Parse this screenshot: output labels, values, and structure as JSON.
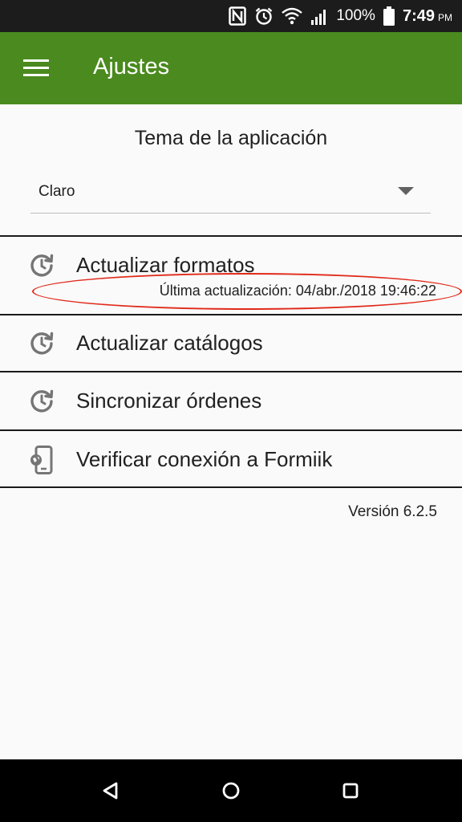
{
  "status_bar": {
    "battery_percent": "100%",
    "time": "7:49",
    "ampm": "PM",
    "icons": [
      "nfc-icon",
      "alarm-icon",
      "wifi-icon",
      "signal-icon",
      "battery-icon"
    ]
  },
  "app_bar": {
    "title": "Ajustes",
    "color": "#4a8a1e",
    "menu_icon": "hamburger-menu-icon"
  },
  "theme": {
    "title": "Tema de la aplicación",
    "selected": "Claro"
  },
  "settings": [
    {
      "label": "Actualizar formatos",
      "subtitle": "Última actualización: 04/abr./2018 19:46:22",
      "icon": "update-history-icon"
    },
    {
      "label": "Actualizar catálogos",
      "icon": "update-history-icon"
    },
    {
      "label": "Sincronizar órdenes",
      "icon": "update-history-icon"
    },
    {
      "label": "Verificar conexión a Formiik",
      "icon": "phone-connection-icon"
    }
  ],
  "version": "Versión 6.2.5",
  "annotation": {
    "color": "#e02a1a",
    "shape": "ellipse"
  },
  "nav_bar": {
    "icons": [
      "back-icon",
      "home-icon",
      "recents-icon"
    ]
  }
}
